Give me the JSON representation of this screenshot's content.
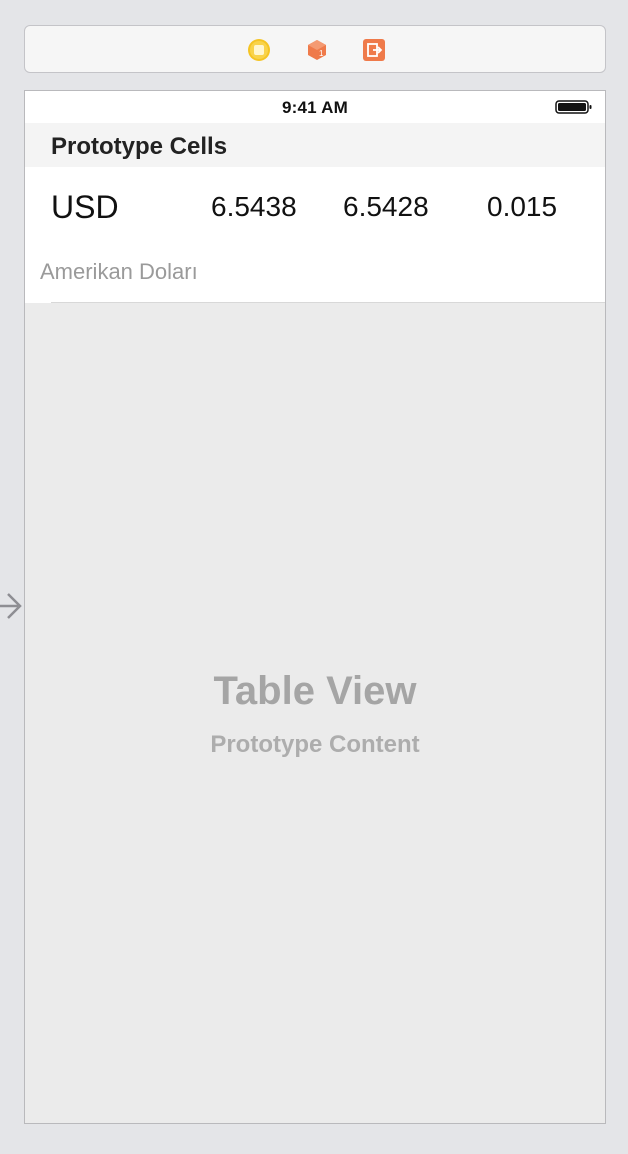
{
  "scene_dock": {
    "icons": [
      "view-controller-icon",
      "first-responder-icon",
      "exit-icon"
    ]
  },
  "device": {
    "status_bar": {
      "time": "9:41 AM"
    },
    "section_header": "Prototype Cells",
    "prototype_cell": {
      "code": "USD",
      "buy": "6.5438",
      "sell": "6.5428",
      "change": "0.015",
      "name": "Amerikan Doları"
    },
    "placeholder": {
      "title": "Table View",
      "subtitle": "Prototype Content"
    }
  },
  "colors": {
    "accent_yellow": "#f5c423",
    "accent_orange": "#ef7a4a"
  }
}
